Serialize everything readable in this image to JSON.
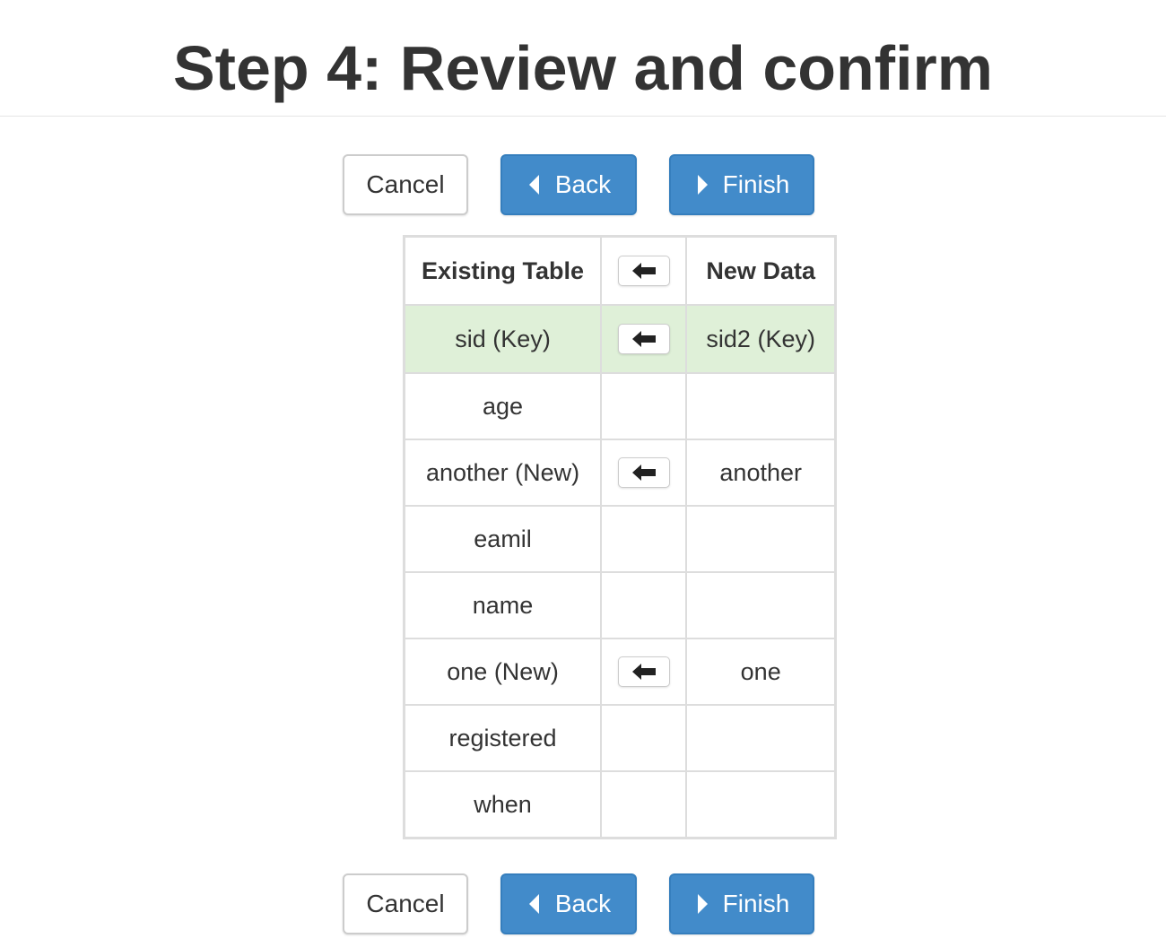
{
  "page": {
    "title": "Step 4: Review and confirm"
  },
  "buttons": {
    "cancel_label": "Cancel",
    "back_label": "Back",
    "finish_label": "Finish",
    "back_icon": "caret-left-icon",
    "finish_icon": "caret-right-icon"
  },
  "colors": {
    "primary": "#428bca",
    "key_row": "#dff0d8",
    "border": "#dddddd"
  },
  "mapping_table": {
    "headers": {
      "existing": "Existing Table",
      "arrow_icon": "arrow-left-icon",
      "new": "New Data"
    },
    "rows": [
      {
        "existing": "sid (Key)",
        "has_arrow": true,
        "new": "sid2 (Key)",
        "is_key": true
      },
      {
        "existing": "age",
        "has_arrow": false,
        "new": ""
      },
      {
        "existing": "another (New)",
        "has_arrow": true,
        "new": "another"
      },
      {
        "existing": "eamil",
        "has_arrow": false,
        "new": ""
      },
      {
        "existing": "name",
        "has_arrow": false,
        "new": ""
      },
      {
        "existing": "one (New)",
        "has_arrow": true,
        "new": "one"
      },
      {
        "existing": "registered",
        "has_arrow": false,
        "new": ""
      },
      {
        "existing": "when",
        "has_arrow": false,
        "new": ""
      }
    ]
  }
}
